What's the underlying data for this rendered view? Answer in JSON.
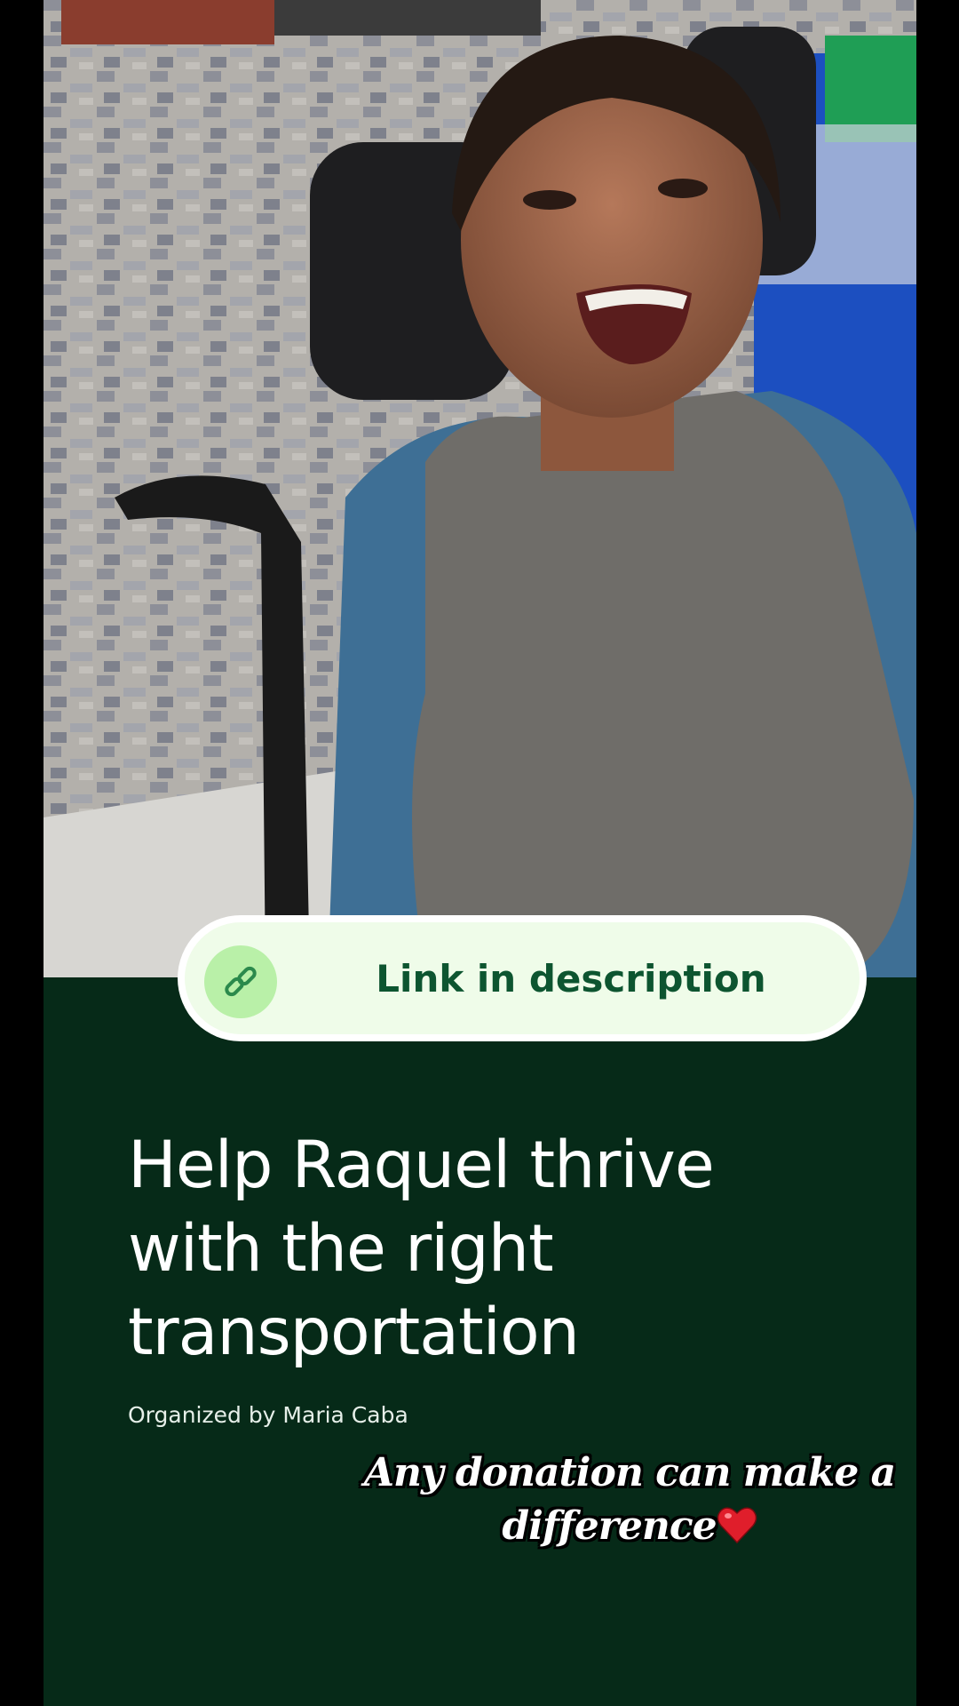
{
  "photo": {
    "subject": "smiling girl in wheelchair"
  },
  "link_pill": {
    "icon": "link-icon",
    "label": "Link in description"
  },
  "fundraiser": {
    "title_lines": [
      "Help Raquel thrive",
      "with the right",
      "transportation"
    ],
    "organizer": "Organized by Maria Caba"
  },
  "caption": {
    "line1": "Any donation can make a",
    "line2": "difference",
    "emoji": "heart-emoji"
  },
  "colors": {
    "background": "#062a18",
    "pill": "#effce9",
    "pill_text": "#0d5530",
    "icon_circle": "#b9f0a8"
  }
}
